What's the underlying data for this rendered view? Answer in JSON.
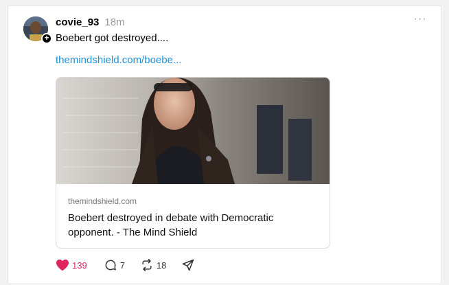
{
  "post": {
    "username": "covie_93",
    "time": "18m",
    "text": "Boebert got destroyed....",
    "link_text": "themindshield.com/boebe...",
    "more_label": "···",
    "follow_badge": "+"
  },
  "link_preview": {
    "domain": "themindshield.com",
    "title": "Boebert destroyed in debate with Democratic opponent. - The Mind Shield"
  },
  "actions": {
    "likes": "139",
    "replies": "7",
    "reposts": "18"
  },
  "colors": {
    "like": "#e0245e",
    "link": "#1d90d8",
    "muted": "#999999"
  },
  "icons": [
    "heart-icon",
    "comment-icon",
    "repost-icon",
    "share-icon",
    "more-icon",
    "plus-icon"
  ]
}
